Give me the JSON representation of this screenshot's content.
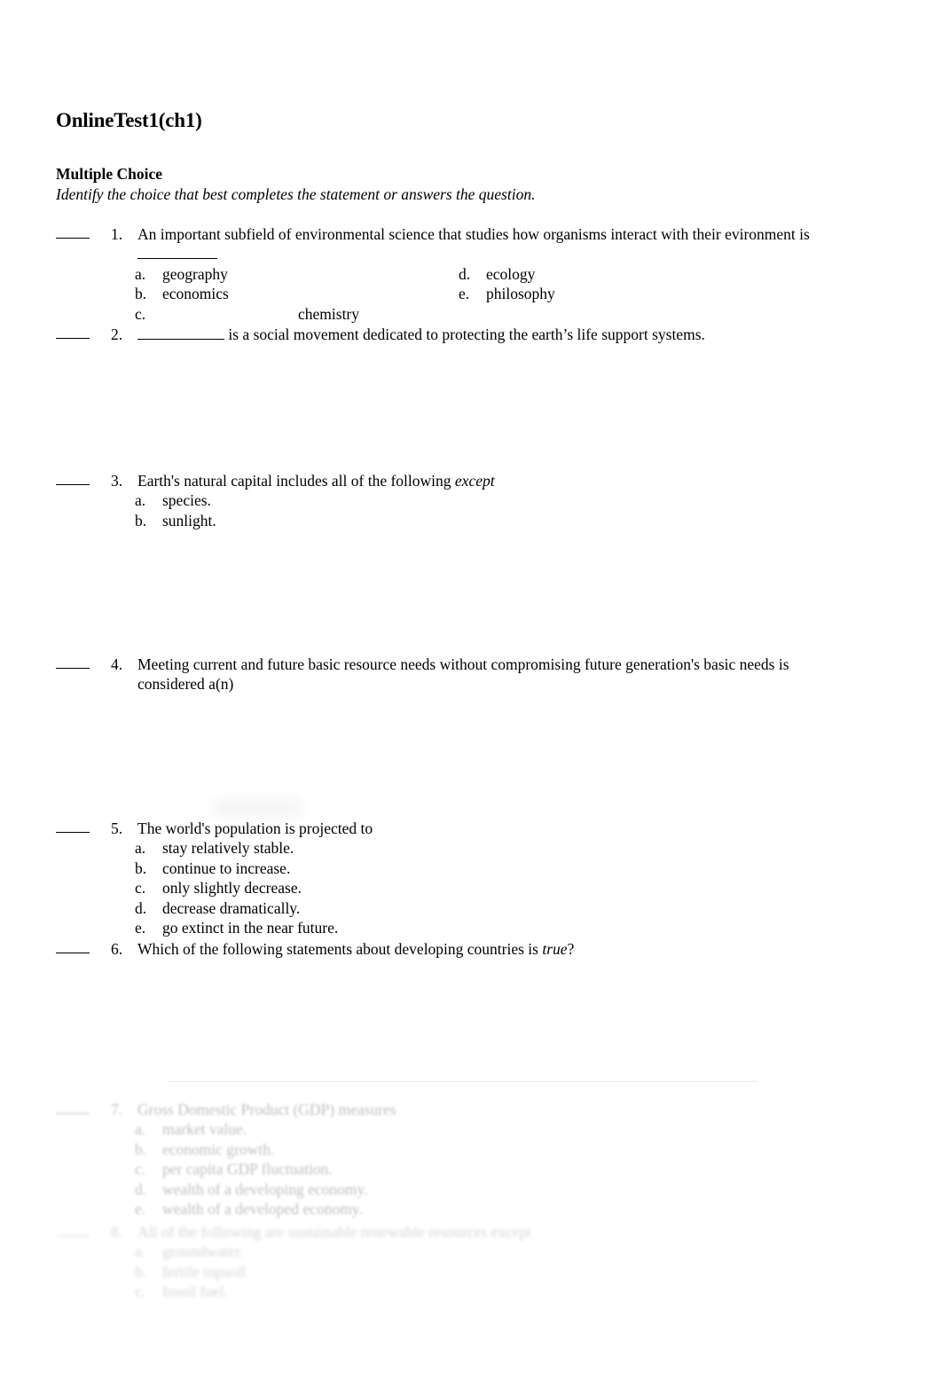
{
  "document": {
    "title": "OnlineTest1(ch1)",
    "section_heading": "Multiple Choice",
    "section_instruction": "Identify the choice that best completes the statement or answers the question."
  },
  "questions": [
    {
      "number": "1.",
      "text": "An important subfield of environmental science that studies how organisms interact with their evironment is",
      "has_trailing_blank_line": true,
      "layout": "two-column",
      "options_left": [
        {
          "letter": "a.",
          "text": "geography"
        },
        {
          "letter": "b.",
          "text": "economics"
        },
        {
          "letter": "c.",
          "text": "chemistry",
          "far_indent": true
        }
      ],
      "options_right": [
        {
          "letter": "d.",
          "text": "ecology"
        },
        {
          "letter": "e.",
          "text": "philosophy"
        }
      ]
    },
    {
      "number": "2.",
      "text_before_blank": "",
      "text_after_blank": " is a social movement dedicated to protecting the earth’s life support systems.",
      "layout": "inline-blank",
      "options_left": [],
      "options_right": []
    },
    {
      "number": "3.",
      "text_plain": "Earth's natural capital includes all of the following ",
      "text_italic": "except",
      "text_tail": "",
      "layout": "single-column",
      "options_left": [
        {
          "letter": "a.",
          "text": "species."
        },
        {
          "letter": "b.",
          "text": "sunlight."
        }
      ],
      "options_right": []
    },
    {
      "number": "4.",
      "text": "Meeting current and future basic resource needs without compromising future generation's basic needs is considered a(n)",
      "layout": "single-column",
      "options_left": [],
      "options_right": []
    },
    {
      "number": "5.",
      "text": "The world's population is projected to",
      "layout": "single-column",
      "options_left": [
        {
          "letter": "a.",
          "text": "stay relatively stable."
        },
        {
          "letter": "b.",
          "text": "continue to increase."
        },
        {
          "letter": "c.",
          "text": "only slightly decrease."
        },
        {
          "letter": "d.",
          "text": "decrease dramatically."
        },
        {
          "letter": "e.",
          "text": "go extinct in the near future."
        }
      ],
      "options_right": []
    },
    {
      "number": "6.",
      "text_plain": "Which of the following statements about developing countries is ",
      "text_italic": "true",
      "text_tail": "?",
      "layout": "single-column",
      "options_left": [],
      "options_right": []
    },
    {
      "number": "7.",
      "text": "Gross Domestic Product (GDP) measures",
      "layout": "single-column",
      "faded": true,
      "options_left": [
        {
          "letter": "a.",
          "text": "market value."
        },
        {
          "letter": "b.",
          "text": "economic growth."
        },
        {
          "letter": "c.",
          "text": "per capita GDP fluctuation."
        },
        {
          "letter": "d.",
          "text": "wealth of a developing economy."
        },
        {
          "letter": "e.",
          "text": "wealth of a developed economy."
        }
      ],
      "options_right": []
    },
    {
      "number": "8.",
      "text": "All of the following are sustainable renewable resources except",
      "layout": "single-column",
      "faded": true,
      "options_left": [
        {
          "letter": "a.",
          "text": "groundwater."
        },
        {
          "letter": "b.",
          "text": "fertile topsoil."
        },
        {
          "letter": "c.",
          "text": "fossil fuel."
        }
      ],
      "options_right": []
    }
  ]
}
